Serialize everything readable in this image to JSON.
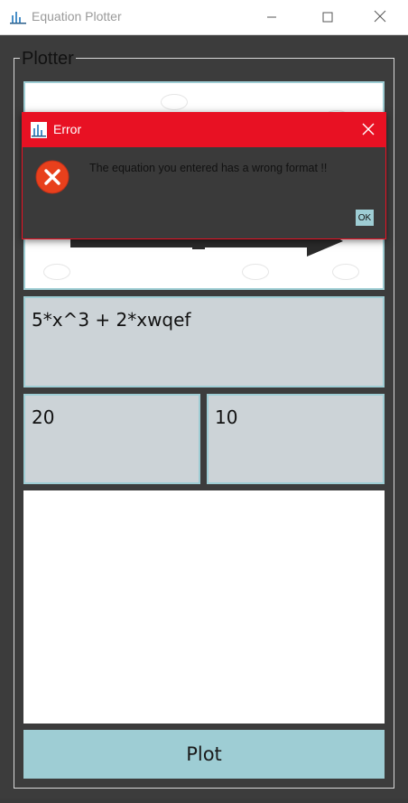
{
  "window": {
    "title": "Equation Plotter"
  },
  "plotter": {
    "legend": "Plotter",
    "equation_value": "5*x^3 + 2*xwqef",
    "x_value": "20",
    "y_value": "10",
    "plot_label": "Plot"
  },
  "dialog": {
    "title": "Error",
    "message": "The equation you entered has a wrong format !!",
    "ok_label": "OK"
  },
  "colors": {
    "accent": "#9ecdd4",
    "error": "#e81123",
    "input_bg": "#ccd3d7",
    "window_bg": "#3c3c3c"
  },
  "icons": {
    "app": "chart-icon",
    "minimize": "minimize-icon",
    "maximize": "maximize-icon",
    "close": "close-icon",
    "error": "error-icon"
  }
}
